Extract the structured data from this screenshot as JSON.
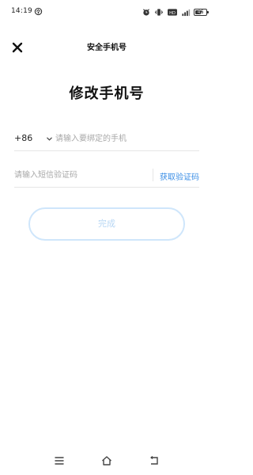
{
  "status_bar": {
    "time": "14:19",
    "battery_level": "46",
    "icons": [
      "notification-icon",
      "alarm-icon",
      "vibrate-icon",
      "wifi-icon",
      "signal-icon",
      "battery-icon"
    ]
  },
  "header": {
    "title": "安全手机号",
    "close_icon": "close-icon"
  },
  "page": {
    "title": "修改手机号"
  },
  "phone": {
    "country_code": "+86",
    "value": "",
    "placeholder": "请输入要绑定的手机"
  },
  "code": {
    "value": "",
    "placeholder": "请输入短信验证码",
    "get_code_label": "获取验证码"
  },
  "submit": {
    "label": "完成"
  },
  "nav": {
    "icons": [
      "menu-icon",
      "home-icon",
      "back-icon"
    ]
  },
  "colors": {
    "link": "#3a8ee6",
    "button_border": "#cfe6fb",
    "button_text": "#b8d7f4",
    "divider": "#e6e6e6",
    "placeholder": "#a8a8a8"
  }
}
